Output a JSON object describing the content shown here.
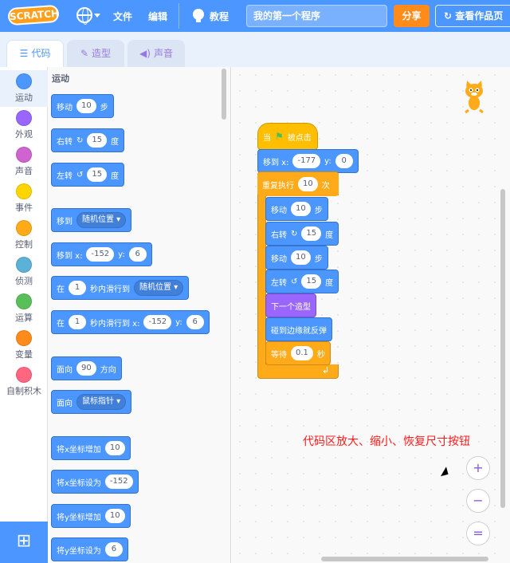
{
  "menubar": {
    "logo": "SCRATCH",
    "file": "文件",
    "edit": "编辑",
    "tutorials": "教程",
    "project_title": "我的第一个程序",
    "share": "分享",
    "see_project": "查看作品页"
  },
  "tabs": [
    {
      "label": "代码",
      "icon": "code-icon"
    },
    {
      "label": "造型",
      "icon": "brush-icon"
    },
    {
      "label": "声音",
      "icon": "speaker-icon"
    }
  ],
  "categories": [
    {
      "label": "运动",
      "color": "#4c97ff"
    },
    {
      "label": "外观",
      "color": "#9966ff"
    },
    {
      "label": "声音",
      "color": "#cf63cf"
    },
    {
      "label": "事件",
      "color": "#ffd500"
    },
    {
      "label": "控制",
      "color": "#ffab19"
    },
    {
      "label": "侦测",
      "color": "#5cb1d6"
    },
    {
      "label": "运算",
      "color": "#59c059"
    },
    {
      "label": "变量",
      "color": "#ff8c1a"
    },
    {
      "label": "自制积木",
      "color": "#ff6680"
    }
  ],
  "palette": {
    "heading": "运动",
    "move": {
      "pre": "移动",
      "val": "10",
      "post": "步"
    },
    "turn_right": {
      "pre": "右转",
      "val": "15",
      "post": "度"
    },
    "turn_left": {
      "pre": "左转",
      "val": "15",
      "post": "度"
    },
    "goto": {
      "pre": "移到",
      "dd": "随机位置"
    },
    "goto_xy": {
      "pre": "移到 x:",
      "x": "-152",
      "ylabel": "y:",
      "y": "6"
    },
    "glide": {
      "pre": "在",
      "val": "1",
      "mid": "秒内滑行到",
      "dd": "随机位置"
    },
    "glide_xy": {
      "pre": "在",
      "val": "1",
      "mid": "秒内滑行到 x:",
      "x": "-152",
      "ylabel": "y:",
      "y": "6"
    },
    "point_dir": {
      "pre": "面向",
      "val": "90",
      "post": "方向"
    },
    "point_to": {
      "pre": "面向",
      "dd": "鼠标指针"
    },
    "change_x": {
      "pre": "将x坐标增加",
      "val": "10"
    },
    "set_x": {
      "pre": "将x坐标设为",
      "val": "-152"
    },
    "change_y": {
      "pre": "将y坐标增加",
      "val": "10"
    },
    "set_y": {
      "pre": "将y坐标设为",
      "val": "6"
    }
  },
  "script": {
    "hat": {
      "pre": "当",
      "post": "被点击"
    },
    "goto_xy": {
      "pre": "移到 x:",
      "x": "-177",
      "ylabel": "y:",
      "y": "0"
    },
    "repeat": {
      "pre": "重复执行",
      "val": "10",
      "post": "次"
    },
    "move1": {
      "pre": "移动",
      "val": "10",
      "post": "步"
    },
    "turn_right": {
      "pre": "右转",
      "val": "15",
      "post": "度"
    },
    "move2": {
      "pre": "移动",
      "val": "10",
      "post": "步"
    },
    "turn_left": {
      "pre": "左转",
      "val": "15",
      "post": "度"
    },
    "next_costume": "下一个造型",
    "bounce": "碰到边缘就反弹",
    "wait": {
      "pre": "等待",
      "val": "0.1",
      "post": "秒"
    }
  },
  "annotation": "代码区放大、缩小、恢复尺寸按钮",
  "zoom": {
    "in": "+",
    "out": "−",
    "reset": "="
  }
}
